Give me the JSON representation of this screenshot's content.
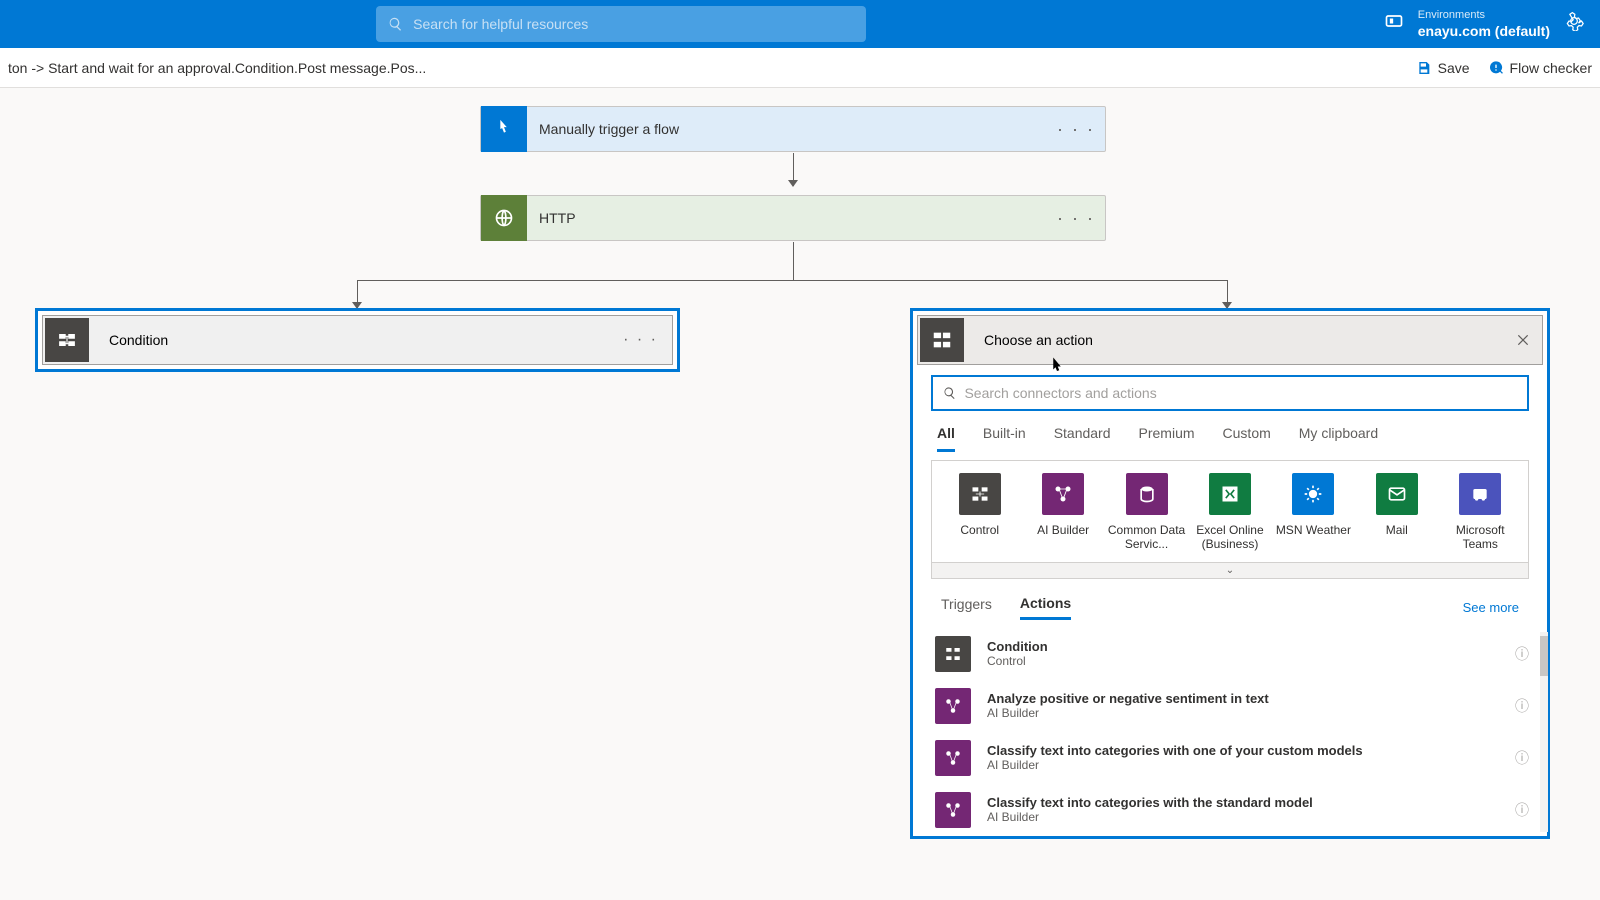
{
  "header": {
    "search_placeholder": "Search for helpful resources",
    "env_label": "Environments",
    "env_name": "enayu.com (default)"
  },
  "breadcrumb": "ton -> Start and wait for an approval.Condition.Post message.Pos...",
  "toolbar": {
    "save": "Save",
    "flow_checker": "Flow checker"
  },
  "trigger_card": {
    "label": "Manually trigger a flow"
  },
  "http_card": {
    "label": "HTTP"
  },
  "condition_card": {
    "label": "Condition"
  },
  "choose_panel": {
    "title": "Choose an action",
    "search_placeholder": "Search connectors and actions",
    "tabs": [
      "All",
      "Built-in",
      "Standard",
      "Premium",
      "Custom",
      "My clipboard"
    ],
    "connectors": [
      {
        "name": "Control",
        "color": "#484644"
      },
      {
        "name": "AI Builder",
        "color": "#742774"
      },
      {
        "name": "Common Data Servic...",
        "color": "#742774"
      },
      {
        "name": "Excel Online (Business)",
        "color": "#107c41"
      },
      {
        "name": "MSN Weather",
        "color": "#0078d4"
      },
      {
        "name": "Mail",
        "color": "#107c41"
      },
      {
        "name": "Microsoft Teams",
        "color": "#4b53bc"
      }
    ],
    "sub_tabs": [
      "Triggers",
      "Actions"
    ],
    "see_more": "See more",
    "actions": [
      {
        "title": "Condition",
        "sub": "Control",
        "color": "#484644"
      },
      {
        "title": "Analyze positive or negative sentiment in text",
        "sub": "AI Builder",
        "color": "#742774"
      },
      {
        "title": "Classify text into categories with one of your custom models",
        "sub": "AI Builder",
        "color": "#742774"
      },
      {
        "title": "Classify text into categories with the standard model",
        "sub": "AI Builder",
        "color": "#742774"
      }
    ]
  }
}
